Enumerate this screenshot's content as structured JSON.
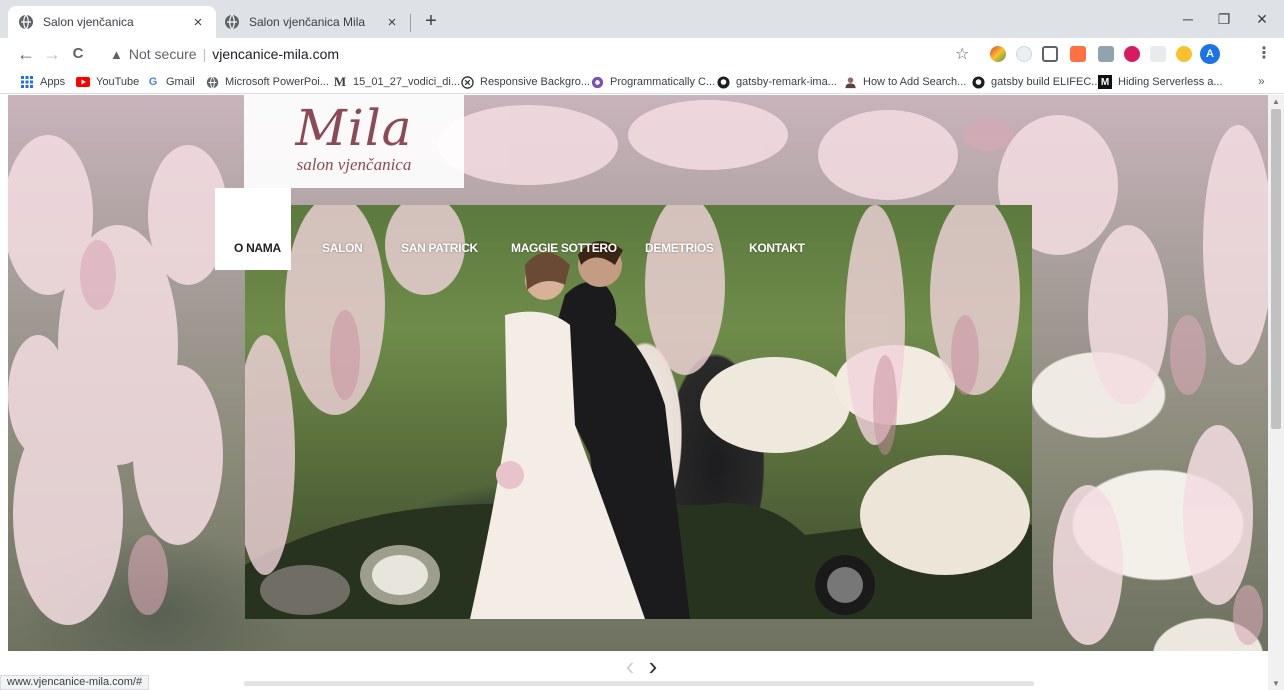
{
  "browser": {
    "tabs": [
      {
        "title": "Salon vjenčanica",
        "active": true
      },
      {
        "title": "Salon vjenčanica Mila",
        "active": false
      }
    ],
    "new_tab": "+",
    "window_controls": {
      "minimize": "─",
      "restore": "❐",
      "close": "✕"
    },
    "nav": {
      "back": "←",
      "forward": "→",
      "reload": "C"
    },
    "address": {
      "security": "Not secure",
      "separator": "|",
      "url": "vjencanice-mila.com"
    },
    "profile_initial": "A",
    "bookmarks": [
      {
        "label": "Apps",
        "icon": "apps-grid-icon"
      },
      {
        "label": "YouTube",
        "icon": "youtube-icon"
      },
      {
        "label": "Gmail",
        "icon": "google-icon"
      },
      {
        "label": "Microsoft PowerPoi...",
        "icon": "globe-icon"
      },
      {
        "label": "15_01_27_vodici_di...",
        "icon": "m-icon"
      },
      {
        "label": "Responsive Backgro...",
        "icon": "circle-x-icon"
      },
      {
        "label": "Programmatically C...",
        "icon": "purple-circle-icon"
      },
      {
        "label": "gatsby-remark-ima...",
        "icon": "github-icon"
      },
      {
        "label": "How to Add Search...",
        "icon": "person-icon"
      },
      {
        "label": "gatsby build ELIFEC...",
        "icon": "github-icon"
      },
      {
        "label": "Hiding Serverless a...",
        "icon": "medium-icon"
      }
    ],
    "bookmarks_more": "»",
    "status_url": "www.vjencanice-mila.com/#"
  },
  "site": {
    "logo": {
      "main": "Mila",
      "sub": "salon vjenčanica"
    },
    "nav": [
      {
        "label": "O NAMA",
        "active": true
      },
      {
        "label": "SALON",
        "active": false
      },
      {
        "label": "SAN PATRICK",
        "active": false
      },
      {
        "label": "MAGGIE SOTTERO",
        "active": false
      },
      {
        "label": "DEMETRIOS",
        "active": false
      },
      {
        "label": "KONTAKT",
        "active": false
      }
    ],
    "carousel": {
      "prev": "‹",
      "next": "›"
    }
  },
  "colors": {
    "logo_accent": "#8b4a55",
    "blossom": "#f2d9df",
    "tab_strip": "#dee1e6"
  }
}
